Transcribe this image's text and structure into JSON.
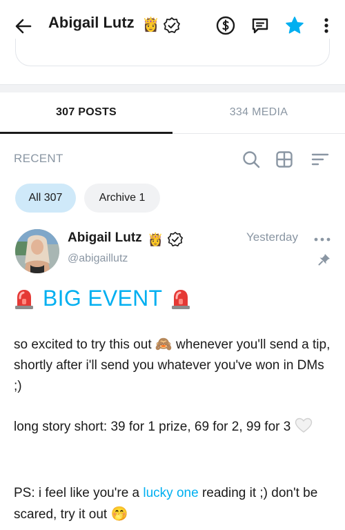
{
  "header": {
    "title": "Abigail Lutz",
    "crown_emoji": "👸",
    "icons": [
      "back-arrow-icon",
      "verified-icon",
      "tip-dollar-icon",
      "message-icon",
      "star-icon",
      "more-vertical-icon"
    ],
    "star_color": "#00aff0"
  },
  "tabs": [
    {
      "label": "307 POSTS",
      "active": true
    },
    {
      "label": "334 MEDIA",
      "active": false
    }
  ],
  "filter_bar": {
    "label": "RECENT",
    "icons": [
      "search-icon",
      "grid-view-icon",
      "sort-icon"
    ]
  },
  "chips": {
    "all": "All 307",
    "archive": "Archive 1"
  },
  "post": {
    "author": "Abigail Lutz",
    "crown_emoji": "👸",
    "handle": "@abigaillutz",
    "time": "Yesterday",
    "headline": "BIG EVENT",
    "p1_before": "so excited to try this out ",
    "p1_emoji": "🙈",
    "p1_after": " whenever you'll send a tip, shortly after i'll send you whatever you've won in DMs ;)",
    "p2": "long story short: 39 for 1 prize, 69 for 2, 99 for 3 ",
    "p3_before": "PS: i feel like you're a ",
    "p3_link": "lucky one",
    "p3_after": " reading it ;) don't be scared, try it out ",
    "p3_emoji": "🤭"
  },
  "colors": {
    "accent": "#00aff0",
    "muted": "#8a96a3",
    "chip_active": "#cfe9f9",
    "chip_inactive": "#f1f2f4"
  }
}
